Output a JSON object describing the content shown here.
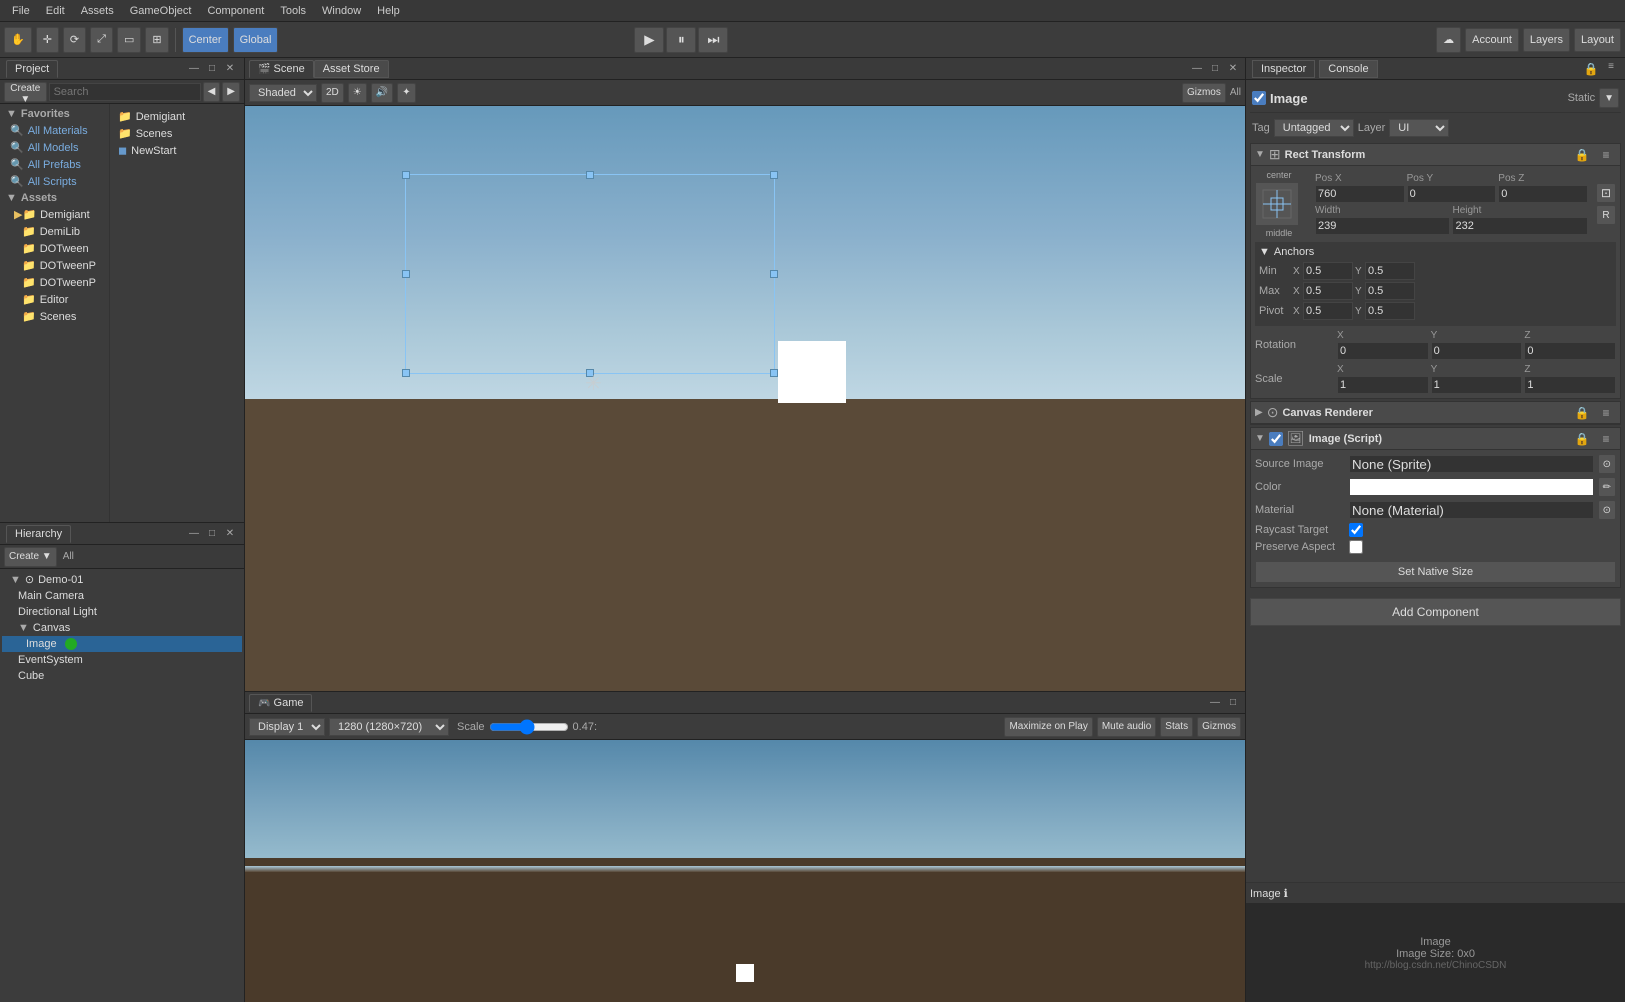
{
  "menubar": {
    "items": [
      "File",
      "Edit",
      "Assets",
      "GameObject",
      "Component",
      "Tools",
      "Window",
      "Help"
    ]
  },
  "toolbar": {
    "hand_label": "✋",
    "move_label": "✛",
    "rotate_label": "⟳",
    "scale_label": "⤢",
    "rect_label": "▭",
    "transform_label": "⊞",
    "center_label": "Center",
    "global_label": "Global",
    "play_icon": "▶",
    "pause_icon": "⏸",
    "step_icon": "⏭",
    "cloud_icon": "☁",
    "account_label": "Account",
    "layers_label": "Layers",
    "layout_label": "Layout"
  },
  "project_panel": {
    "tab": "Project",
    "favorites": {
      "header": "Favorites",
      "items": [
        "All Materials",
        "All Models",
        "All Prefabs",
        "All Scripts"
      ]
    },
    "assets": {
      "header": "Assets",
      "folders": [
        "Demigiant",
        "DemiLib",
        "DOTween",
        "DOTweenP",
        "DOTweenP",
        "Editor",
        "Scenes"
      ],
      "right_items": [
        "Demigiant",
        "Scenes",
        "NewStart"
      ]
    }
  },
  "hierarchy_panel": {
    "tab": "Hierarchy",
    "create_label": "Create",
    "all_label": "All",
    "items": [
      {
        "label": "Demo-01",
        "indent": 0,
        "icon": "▼"
      },
      {
        "label": "Main Camera",
        "indent": 1
      },
      {
        "label": "Directional Light",
        "indent": 1
      },
      {
        "label": "Canvas",
        "indent": 1,
        "icon": "▼"
      },
      {
        "label": "Image",
        "indent": 2,
        "selected": true
      },
      {
        "label": "EventSystem",
        "indent": 1
      },
      {
        "label": "Cube",
        "indent": 1
      }
    ]
  },
  "scene_panel": {
    "tab": "Scene",
    "asset_store_tab": "Asset Store",
    "shaded_dropdown": "Shaded",
    "two_d_btn": "2D",
    "gizmos_btn": "Gizmos",
    "all_label": "All"
  },
  "game_panel": {
    "tab": "Game",
    "display": "Display 1",
    "resolution": "1280 (1280×720)",
    "scale_label": "Scale",
    "scale_value": "0.47:",
    "maximize_label": "Maximize on Play",
    "mute_label": "Mute audio",
    "stats_label": "Stats",
    "gizmos_label": "Gizmos"
  },
  "inspector": {
    "tab": "Inspector",
    "console_tab": "Console",
    "object_name": "Image",
    "tag": "Untagged",
    "layer": "UI",
    "static_label": "Static",
    "rect_transform": {
      "label": "Rect Transform",
      "anchor_preset": "center",
      "pos_x": "760",
      "pos_y": "0",
      "pos_z": "0",
      "width": "239",
      "height": "232",
      "anchors": {
        "label": "Anchors",
        "min_label": "Min",
        "min_x": "0.5",
        "min_y": "0.5",
        "max_label": "Max",
        "max_x": "0.5",
        "max_y": "0.5",
        "pivot_label": "Pivot",
        "pivot_x": "0.5",
        "pivot_y": "0.5"
      },
      "rotation_label": "Rotation",
      "rot_x": "0",
      "rot_y": "0",
      "rot_z": "0",
      "scale_label": "Scale",
      "scale_x": "1",
      "scale_y": "1",
      "scale_z": "1"
    },
    "canvas_renderer": {
      "label": "Canvas Renderer"
    },
    "image_script": {
      "label": "Image (Script)",
      "source_image_label": "Source Image",
      "source_image_value": "None (Sprite)",
      "color_label": "Color",
      "material_label": "Material",
      "material_value": "None (Material)",
      "raycast_label": "Raycast Target",
      "preserve_label": "Preserve Aspect",
      "set_native_label": "Set Native Size"
    },
    "add_component_label": "Add Component"
  },
  "preview": {
    "header": "Image ℹ",
    "name": "Image",
    "size": "Image Size: 0x0",
    "url": "http://blog.csdn.net/ChinoCSDN"
  }
}
